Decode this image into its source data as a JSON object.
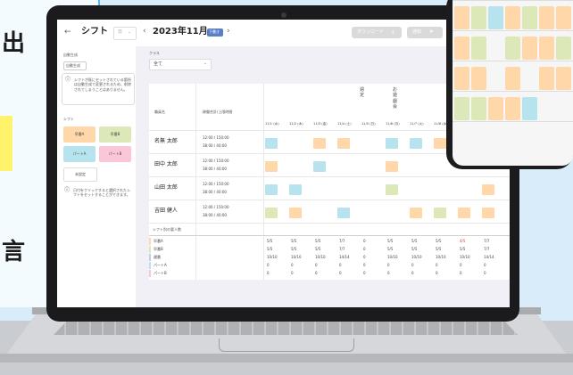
{
  "colors": {
    "early": "#ffd7a8",
    "late": "#dde8b8",
    "partA": "#b7e3ef",
    "partB": "#fbc6d8",
    "accent": "#5cb6e6"
  },
  "promo": {
    "char1": "出",
    "char2": "!",
    "char3": "言"
  },
  "header": {
    "back_icon": "chevron-left-icon",
    "title": "シフト",
    "select_value": "日",
    "prev_icon": "chevron-left-icon",
    "month": "2023年11月",
    "badge": "下書き",
    "next_icon": "chevron-right-icon",
    "download_label": "ダウンロード",
    "notify_label": "通知"
  },
  "sidebar": {
    "auto_title": "自動生成",
    "auto_button": "自動生成",
    "info_text": "シフトが既にセットされている箇所は自動生成で変更されるため、削除されてしまうことはありません。",
    "shift_title": "シフト",
    "shifts": [
      "早番A",
      "早番B",
      "パートA",
      "パートB"
    ],
    "unset": "未設定",
    "hint_text": "日付をクリックすると選択されたシフトをセットすることができます。"
  },
  "main": {
    "class_label": "クラス",
    "class_value": "全て",
    "col_staff": "職員名",
    "col_hours": "稼働合計/上限時間",
    "special_days": [
      "週\n定",
      "お\n遊\n戯\n会"
    ],
    "dates": [
      "11/1 (水)",
      "11/2 (木)",
      "11/3 (金)",
      "11/4 (土)",
      "11/5 (日)",
      "11/6 (月)",
      "11/7 (火)",
      "11/8 (水)",
      "11/9 (木)",
      "11/10 (金)"
    ],
    "staff": [
      {
        "name": "名無 太郎",
        "hours1": "12:00 / 150:00",
        "hours2": "38:00 / 40:00"
      },
      {
        "name": "田中 太郎",
        "hours1": "12:00 / 150:00",
        "hours2": "38:00 / 40:00"
      },
      {
        "name": "山田 太郎",
        "hours1": "12:00 / 150:00",
        "hours2": "38:00 / 40:00"
      },
      {
        "name": "吉田 健人",
        "hours1": "12:00 / 150:00",
        "hours2": "38:00 / 40:00"
      }
    ],
    "summary_title": "シフト別の要人数",
    "summary": [
      {
        "label": "早番A",
        "values": [
          "5/5",
          "5/5",
          "5/5",
          "7/7",
          "0",
          "5/5",
          "5/5",
          "5/5",
          "4/5",
          "7/7"
        ]
      },
      {
        "label": "早番B",
        "values": [
          "5/5",
          "5/5",
          "5/5",
          "7/7",
          "0",
          "5/5",
          "5/5",
          "5/5",
          "5/5",
          "7/7"
        ]
      },
      {
        "label": "遅番",
        "values": [
          "10/10",
          "10/10",
          "10/10",
          "14/14",
          "0",
          "10/10",
          "10/10",
          "10/10",
          "10/10",
          "14/14"
        ]
      },
      {
        "label": "パートA",
        "values": [
          "0",
          "0",
          "0",
          "0",
          "0",
          "0",
          "0",
          "0",
          "0",
          "0"
        ]
      },
      {
        "label": "パートB",
        "values": [
          "0",
          "0",
          "0",
          "0",
          "0",
          "0",
          "0",
          "0",
          "0",
          "0"
        ]
      }
    ]
  }
}
